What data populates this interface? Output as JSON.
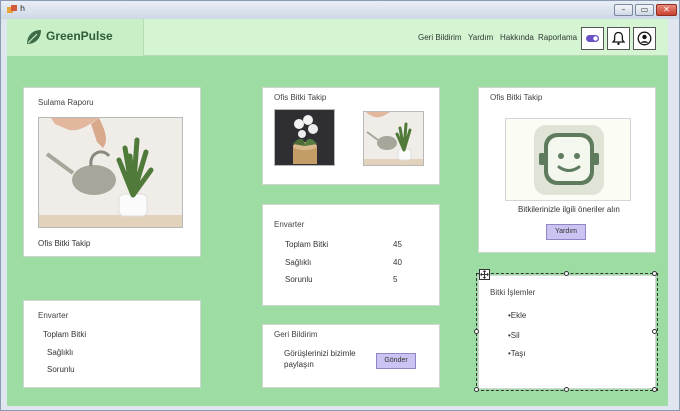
{
  "window": {
    "title": "h"
  },
  "header": {
    "brand": "GreenPulse",
    "nav": [
      "Geri Bildirim",
      "Yardım",
      "Hakkında",
      "Raporlama"
    ]
  },
  "colors": {
    "background": "#9ddda4",
    "header": "#d4f4d2",
    "button": "#cbc4f2",
    "brand": "#2f5d3b"
  },
  "sulama": {
    "title": "Sulama Raporu",
    "caption": "Ofis Bitki Takip"
  },
  "takip": {
    "title": "Ofis Bitki Takip"
  },
  "onerı": {
    "title": "Ofis Bitki Takip",
    "text": "Bitkilerinizle ilgili öneriler alın",
    "button": "Yardım"
  },
  "envanter_mid": {
    "title": "Envarter",
    "rows": [
      {
        "label": "Toplam Bitki",
        "value": "45"
      },
      {
        "label": "Sağlıklı",
        "value": "40"
      },
      {
        "label": "Sorunlu",
        "value": "5"
      }
    ]
  },
  "envanter_left": {
    "title": "Envarter",
    "rows": [
      "Toplam  Bitki",
      "Sağlıklı",
      "Sorunlu"
    ]
  },
  "geri": {
    "title": "Geri Bildirim",
    "line1": "Görüşlerinizi bizimle",
    "line2": "paylaşın",
    "button": "Gönder"
  },
  "islemler": {
    "title": "Bitki İşlemler",
    "items": [
      "•Ekle",
      "•Sil",
      "•Taşı"
    ]
  },
  "icons": [
    "app-icon",
    "leaf-icon",
    "toggle-icon",
    "bell-icon",
    "user-icon",
    "robot-icon",
    "move-icon"
  ]
}
